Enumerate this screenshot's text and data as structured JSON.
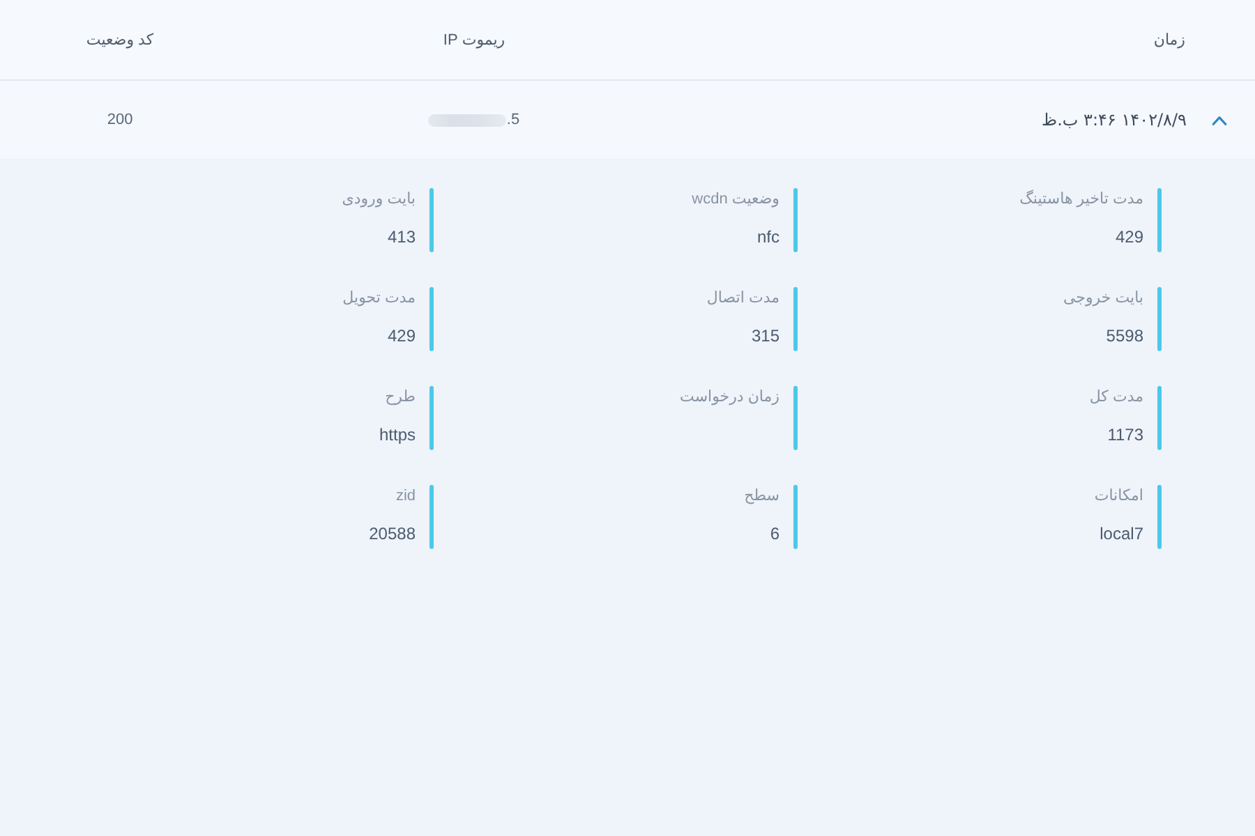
{
  "table": {
    "columns": [
      "زمان",
      "ریموت IP",
      "کد وضعیت"
    ],
    "rows": [
      {
        "time": "۱۴۰۲/۸/۹ ۳:۴۶ ب.ظ",
        "remote_ip": {
          "text": ".5",
          "redacted": true
        },
        "status_code": "200",
        "expanded": true,
        "details": [
          {
            "label": "مدت تاخیر هاستینگ",
            "value": "429"
          },
          {
            "label": "وضعیت wcdn",
            "value": "nfc"
          },
          {
            "label": "بایت ورودی",
            "value": "413"
          },
          {
            "label": "بایت خروجی",
            "value": "5598"
          },
          {
            "label": "مدت اتصال",
            "value": "315"
          },
          {
            "label": "مدت تحویل",
            "value": "429"
          },
          {
            "label": "مدت کل",
            "value": "1173"
          },
          {
            "label": "زمان درخواست"
          },
          {
            "label": "طرح",
            "value": "https"
          },
          {
            "label": "امکانات",
            "value": "local7"
          },
          {
            "label": "سطح",
            "value": "6"
          },
          {
            "label": "zid",
            "value": "20588"
          }
        ]
      }
    ]
  }
}
